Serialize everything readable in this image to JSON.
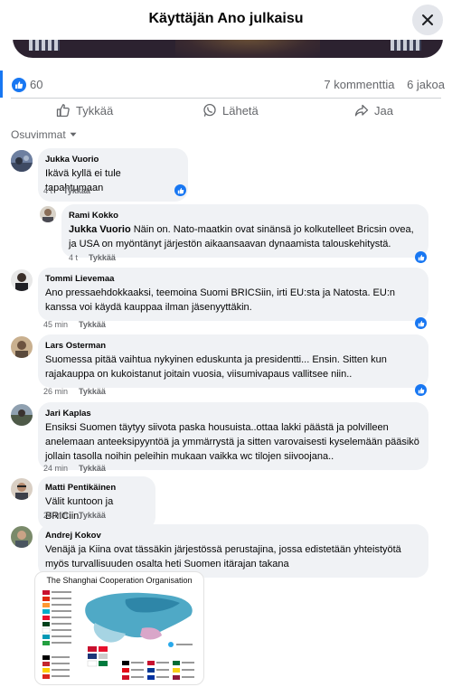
{
  "header": {
    "title": "Käyttäjän Ano julkaisu"
  },
  "post": {
    "like_count": "60",
    "comments": "7 kommenttia",
    "shares": "6 jakoa"
  },
  "actions": {
    "like": "Tykkää",
    "send": "Lähetä",
    "share": "Jaa"
  },
  "sort": {
    "label": "Osuvimmat"
  },
  "comments": [
    {
      "author": "Jukka Vuorio",
      "text": "Ikävä kyllä ei tule tapahtumaan",
      "time": "4 t",
      "like": "Tykkää",
      "reply": ""
    },
    {
      "author": "Rami Kokko",
      "mention": "Jukka Vuorio",
      "text": " Näin on. Nato-maatkin ovat sinänsä jo kolkutelleet Bricsin ovea, ja USA on myöntänyt järjestön aikaansaavan dynaamista talouskehitystä.",
      "time": "4 t",
      "like": "Tykkää"
    },
    {
      "author": "Tommi Lievemaa",
      "text": "Ano pressaehdokkaaksi, teemoina Suomi BRICSiin, irti EU:sta ja Natosta. EU:n kanssa voi käydä kauppaa ilman jäsenyyttäkin.",
      "time": "45 min",
      "like": "Tykkää"
    },
    {
      "author": "Lars Osterman",
      "text": "Suomessa pitää vaihtua nykyinen eduskunta ja presidentti... Ensin. Sitten kun rajakauppa on kukoistanut joitain vuosia, viisumivapaus vallitsee niin..",
      "time": "26 min",
      "like": "Tykkää"
    },
    {
      "author": "Jari Kaplas",
      "text": "Ensiksi Suomen täytyy siivota paska housuista..ottaa lakki päästä ja polvilleen anelemaan anteeksipyyntöä ja ymmärrystä ja sitten varovaisesti kyselemään pääsikö jollain tasolla noihin peleihin mukaan vaikka wc tilojen siivoojana..",
      "time": "24 min",
      "like": "Tykkää"
    },
    {
      "author": "Matti Pentikäinen",
      "text": "Välit kuntoon ja BRICiin.",
      "time": "24 min",
      "like": "Tykkää"
    },
    {
      "author": "Andrej Kokov",
      "text": "Venäjä ja Kiina ovat tässäkin järjestössä perustajina, jossa edistetään yhteistyötä myös turvallisuuden osalta heti Suomen itärajan takana",
      "time": "",
      "like": ""
    }
  ],
  "attachment": {
    "title": "The Shanghai Cooperation Organisation"
  },
  "colors": {
    "accent": "#1877f2",
    "bubble": "#f0f2f5",
    "muted": "#65676b"
  },
  "icons": [
    "close-icon",
    "like-badge-icon",
    "thumb-up-icon",
    "whatsapp-icon",
    "share-arrow-icon",
    "caret-down-icon"
  ]
}
